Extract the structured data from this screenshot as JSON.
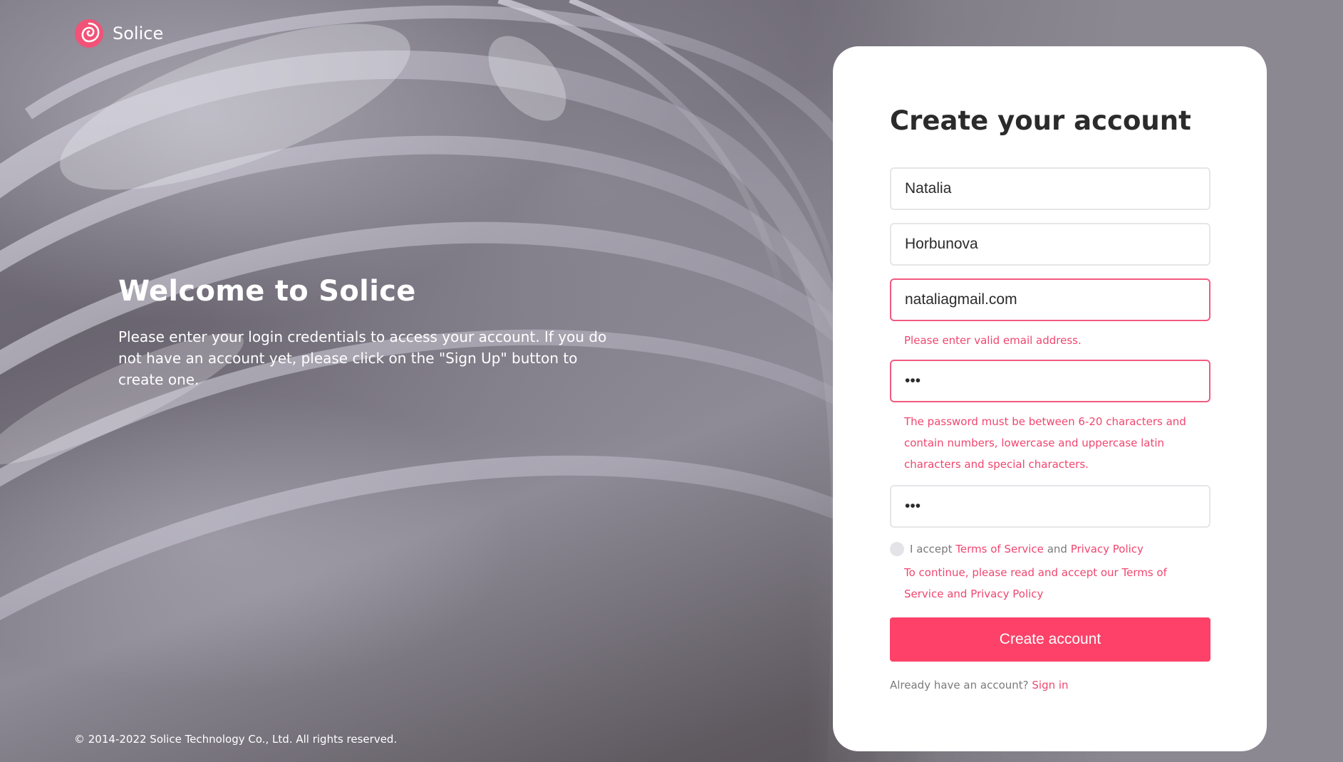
{
  "brand": {
    "name": "Solice",
    "logo_icon": "spiral-logo-icon",
    "accent_color": "#fd4168"
  },
  "welcome": {
    "title": "Welcome to Solice",
    "text": "Please enter your login credentials to access your account. If you do not have an account yet, please click on the \"Sign Up\" button to create one."
  },
  "footer": {
    "copyright": "© 2014-2022 Solice Technology Co., Ltd. All rights reserved."
  },
  "form": {
    "title": "Create your account",
    "first_name": {
      "value": "Natalia"
    },
    "last_name": {
      "value": "Horbunova"
    },
    "email": {
      "value": "nataliagmail.com",
      "error": "Please enter valid email address."
    },
    "password": {
      "value": "abc",
      "error": "The password must be between 6-20 characters and contain numbers, lowercase and uppercase latin characters and special characters."
    },
    "confirm_password": {
      "value": "abc"
    },
    "accept": {
      "prefix": "I accept",
      "terms_link": "Terms of Service",
      "and": "and",
      "privacy_link": "Privacy Policy",
      "error": "To continue, please read and accept our Terms of Service and Privacy Policy"
    },
    "submit_label": "Create account",
    "signin": {
      "prompt": "Already have an account?",
      "link": "Sign in"
    }
  }
}
